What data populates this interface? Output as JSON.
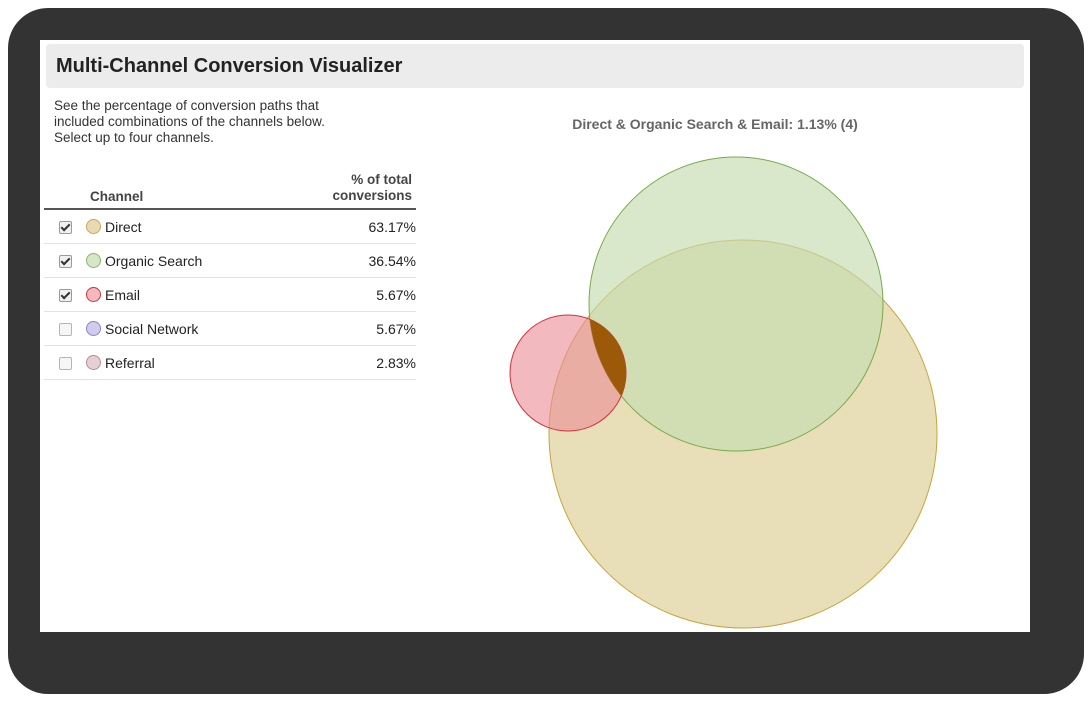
{
  "header": {
    "title": "Multi-Channel Conversion Visualizer"
  },
  "description": {
    "lines": [
      "See the percentage of conversion paths that",
      "included combinations of the channels below.",
      "Select up to four channels."
    ]
  },
  "table": {
    "col_channel": "Channel",
    "col_pct_line1": "% of total",
    "col_pct_line2": "conversions",
    "rows": [
      {
        "label": "Direct",
        "pct": "63.17%",
        "checked": true,
        "color": "#e8dab2",
        "border": "#c7a85a"
      },
      {
        "label": "Organic Search",
        "pct": "36.54%",
        "checked": true,
        "color": "#d6e6c8",
        "border": "#8cb36a"
      },
      {
        "label": "Email",
        "pct": "5.67%",
        "checked": true,
        "color": "#f2b9be",
        "border": "#d6303a"
      },
      {
        "label": "Social Network",
        "pct": "5.67%",
        "checked": false,
        "color": "#d2cbee",
        "border": "#8f80c9"
      },
      {
        "label": "Referral",
        "pct": "2.83%",
        "checked": false,
        "color": "#e6cfd2",
        "border": "#b58d92"
      }
    ]
  },
  "chart": {
    "title": "Direct & Organic Search & Email: 1.13% (4)",
    "colors": {
      "direct_fill": "#e8dfb9",
      "direct_stroke": "#c9a43a",
      "organic_fill": "#c5dcae",
      "organic_stroke": "#7aa94a",
      "email_fill": "#e98c95",
      "email_stroke": "#d6303a",
      "intersection_fill": "#9c5a08"
    }
  }
}
